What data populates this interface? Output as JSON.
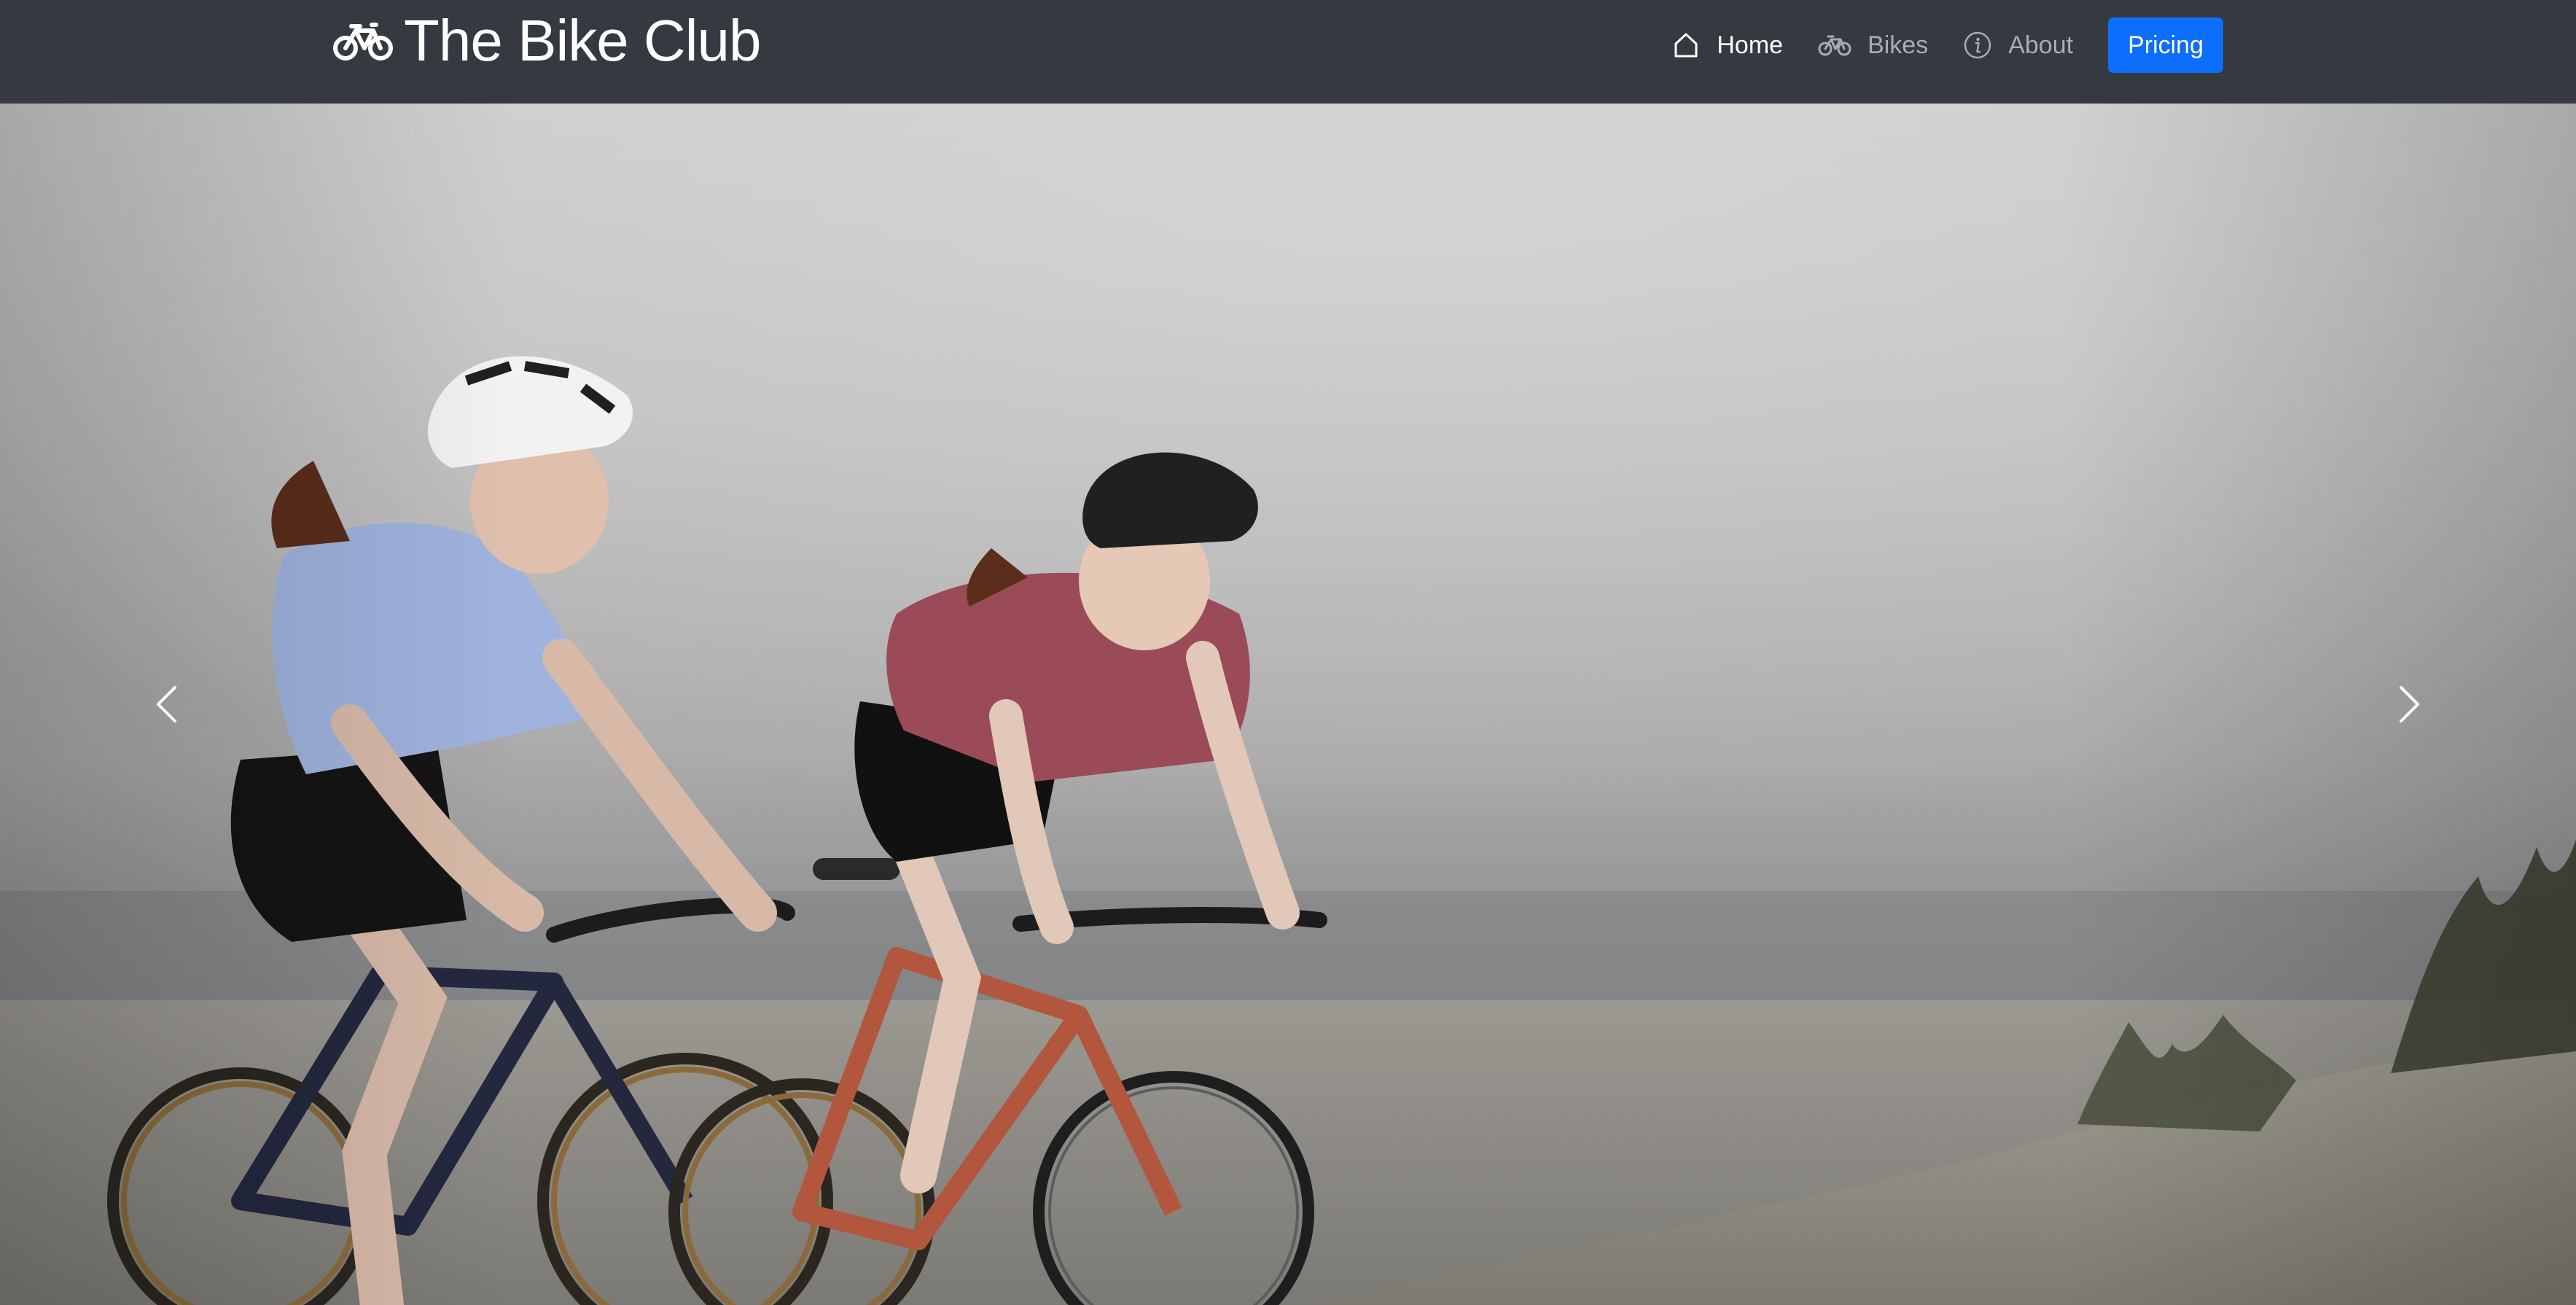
{
  "navbar": {
    "brand": {
      "title": "The Bike Club",
      "icon": "bicycle-icon"
    },
    "links": [
      {
        "label": "Home",
        "icon": "house-icon",
        "active": true
      },
      {
        "label": "Bikes",
        "icon": "bicycle-icon",
        "active": false
      },
      {
        "label": "About",
        "icon": "info-circle-icon",
        "active": false
      }
    ],
    "cta": {
      "label": "Pricing"
    }
  },
  "carousel": {
    "slide": {
      "image": "two-cyclists-riding-road-bikes-on-beach"
    },
    "controls": {
      "prev_icon": "chevron-left-icon",
      "next_icon": "chevron-right-icon"
    }
  },
  "colors": {
    "navbar_bg": "#343a40",
    "link_active": "#ffffff",
    "link_inactive": "#a9adb1",
    "primary": "#0d6efd"
  }
}
